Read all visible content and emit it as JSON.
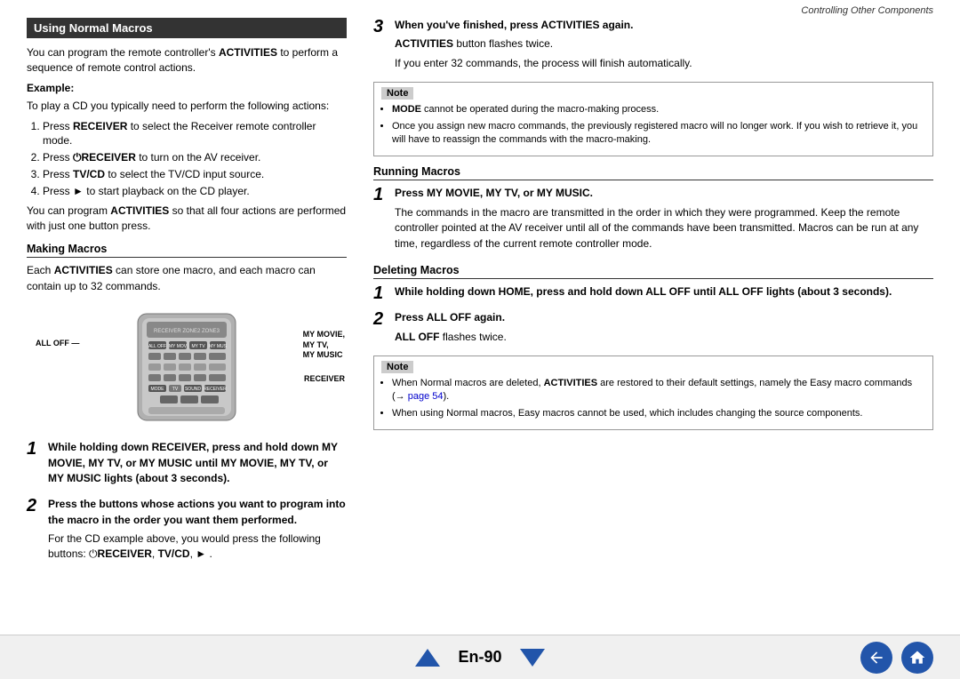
{
  "header": {
    "title": "Controlling Other Components"
  },
  "page_num": "En-90",
  "left": {
    "section_title": "Using Normal Macros",
    "intro1": "You can program the remote controller's ",
    "intro1_bold": "ACTIVITIES",
    "intro2": " to perform a sequence of remote control actions.",
    "example_label": "Example:",
    "example_text": "To play a CD you typically need to perform the following actions:",
    "steps": [
      {
        "num": "1.",
        "text": "Press ",
        "bold": "RECEIVER",
        "rest": " to select the Receiver remote controller mode."
      },
      {
        "num": "2.",
        "text": "Press ",
        "bold": "⏻RECEIVER",
        "rest": " to turn on the AV receiver."
      },
      {
        "num": "3.",
        "text": "Press ",
        "bold": "TV/CD",
        "rest": " to select the TV/CD input source."
      },
      {
        "num": "4.",
        "text": "Press ",
        "bold": "►",
        "rest": " to start playback on the CD player."
      }
    ],
    "summary1": "You can program ",
    "summary1_bold": "ACTIVITIES",
    "summary2": " so that all four actions are performed with just one button press.",
    "making_macros_title": "Making Macros",
    "making_text1": "Each ",
    "making_text1_bold": "ACTIVITIES",
    "making_text2": " can store one macro, and each macro can contain up to 32 commands.",
    "diagram_label_left": "ALL OFF",
    "diagram_label_right1": "MY MOVIE,",
    "diagram_label_right2": "MY TV,",
    "diagram_label_right3": "MY MUSIC",
    "diagram_label_receiver": "RECEIVER",
    "step1_bold": "While holding down RECEIVER, press and hold down MY MOVIE, MY TV, or MY MUSIC until MY MOVIE, MY TV, or MY MUSIC lights (about 3 seconds).",
    "step2_bold": "Press the buttons whose actions you want to program into the macro in the order you want them performed.",
    "step2_rest": "For the CD example above, you would press the following buttons: ⏻",
    "step2_bold2": "RECEIVER",
    "step2_comma": ", ",
    "step2_bold3": "TV/CD",
    "step2_comma2": ", ",
    "step2_end": "►"
  },
  "right": {
    "step3_num": "3",
    "step3_bold": "When you've finished, press ACTIVITIES again.",
    "step3_line1_bold": "ACTIVITIES",
    "step3_line1": " button flashes twice.",
    "step3_line2": "If you enter 32 commands, the process will finish automatically.",
    "note1_label": "Note",
    "note1_bullets": [
      {
        "bold": "MODE",
        "rest": " cannot be operated during the macro-making process."
      },
      {
        "rest": "Once you assign new macro commands, the previously registered macro will no longer work. If you wish to retrieve it, you will have to reassign the commands with the macro-making."
      }
    ],
    "running_macros_title": "Running Macros",
    "run_step1_num": "1",
    "run_step1_bold": "Press MY MOVIE, MY TV, or MY MUSIC.",
    "run_step1_text": "The commands in the macro are transmitted in the order in which they were programmed. Keep the remote controller pointed at the AV receiver until all of the commands have been transmitted. Macros can be run at any time, regardless of the current remote controller mode.",
    "deleting_macros_title": "Deleting Macros",
    "del_step1_num": "1",
    "del_step1_bold": "While holding down HOME, press and hold down ALL OFF until ALL OFF lights (about 3 seconds).",
    "del_step2_num": "2",
    "del_step2_bold": "Press ALL OFF again.",
    "del_step2_rest": " flashes twice.",
    "del_step2_bold_text": "ALL OFF",
    "note2_label": "Note",
    "note2_bullets": [
      {
        "text": "When Normal macros are deleted, ",
        "bold": "ACTIVITIES",
        "rest": " are restored to their default settings, namely the Easy macro commands (→ page 54)."
      },
      {
        "text": "When using Normal macros, Easy macros cannot be used, which includes changing the source components."
      }
    ]
  },
  "footer": {
    "page": "En-90"
  }
}
